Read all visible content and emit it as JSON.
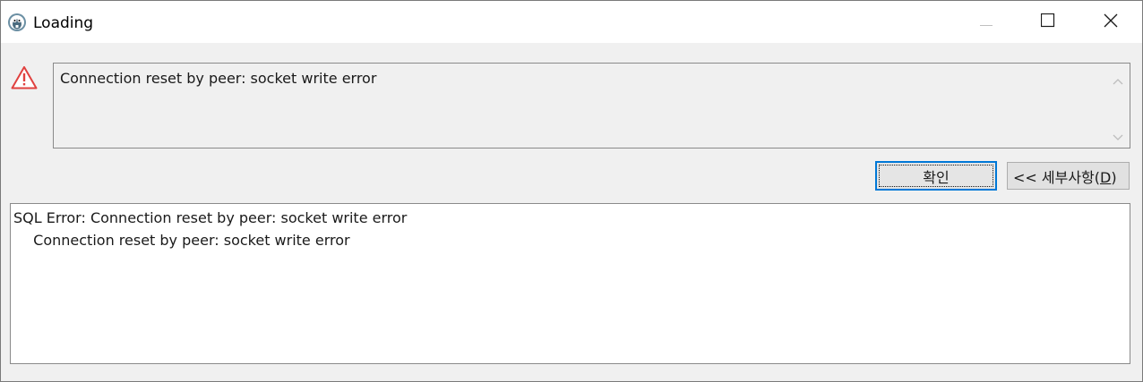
{
  "window": {
    "title": "Loading",
    "app_icon": "dbeaver-beaver-icon",
    "controls": {
      "minimize_icon": "minimize-icon",
      "maximize_icon": "maximize-icon",
      "close_icon": "close-icon"
    }
  },
  "message": {
    "icon": "warning-triangle-icon",
    "text": "Connection reset by peer: socket write error"
  },
  "buttons": {
    "ok_label": "확인",
    "details_prefix": "<< 세부사항(",
    "details_mnemonic": "D",
    "details_suffix": ")"
  },
  "details": {
    "lines": [
      "SQL Error: Connection reset by peer: socket write error",
      "  Connection reset by peer: socket write error"
    ]
  },
  "colors": {
    "focus_border": "#0078d7",
    "warning_red": "#e0413f"
  }
}
